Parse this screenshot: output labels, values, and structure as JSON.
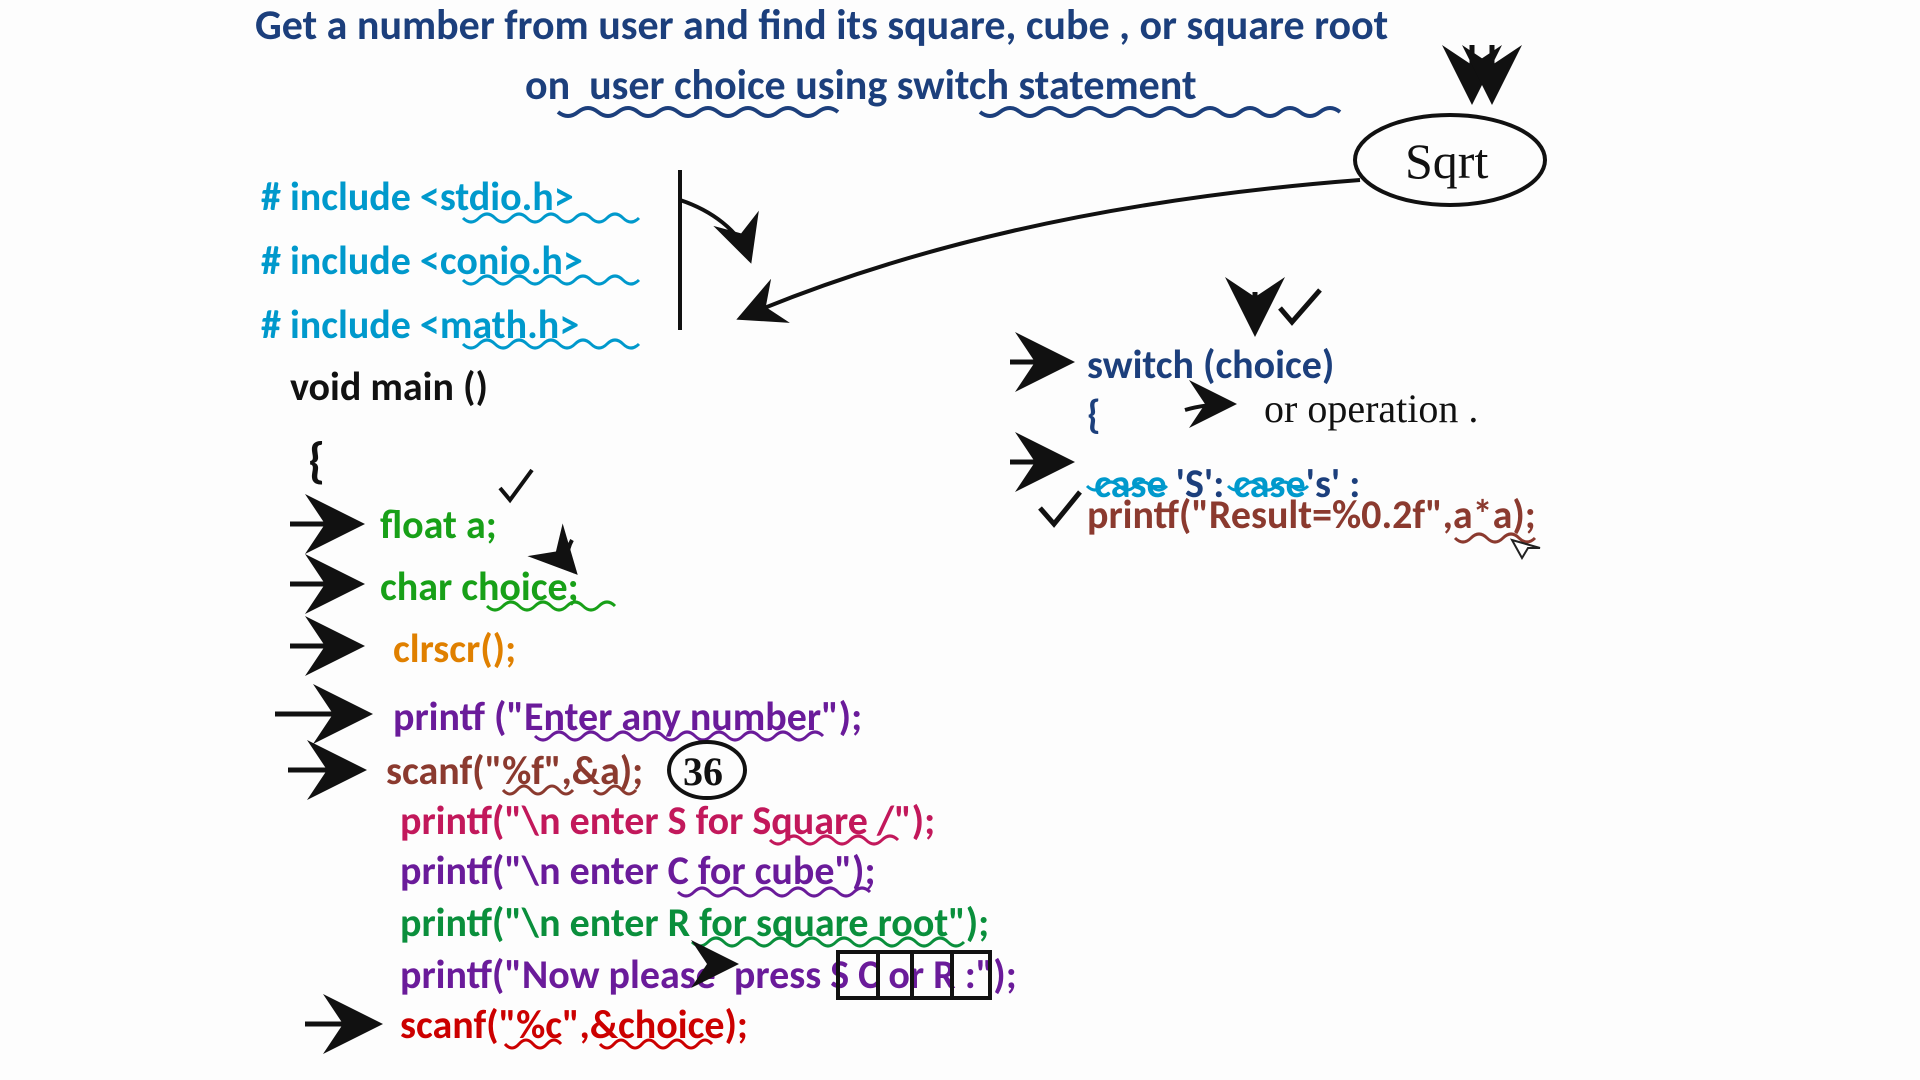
{
  "title_l1": "Get a number from user and find its square, cube , or square root",
  "title_l2": "on  user choice using switch statement",
  "sqrt_note": "Sqrt",
  "inc1": "# include <stdio.h>",
  "inc2": "# include <conio.h>",
  "inc3": "# include <math.h>",
  "main": "void main ()",
  "brace": "{",
  "float": "float a;",
  "char": "char choice;",
  "clr": "clrscr();",
  "p_enter": "printf (\"Enter any number\");",
  "scan1": "scanf(\"%f\",&a);",
  "ex36": "36",
  "p_s": "printf(\"\\n enter S for Square /\");",
  "p_c": "printf(\"\\n enter C for cube\");",
  "p_r": "printf(\"\\n enter R for square root\");",
  "p_now": "printf(\"Now please  press S C or R :\");",
  "scan2": "scanf(\"%c\",&choice);",
  "switch": "switch (choice)",
  "brace2": "{",
  "or_op": "or operation .",
  "case_a": "case",
  "case_sq": " 'S': ",
  "case_b": "case",
  "case_sq2": "'s' :",
  "pres": "printf(\"Result=%0.2f\",a*a);"
}
